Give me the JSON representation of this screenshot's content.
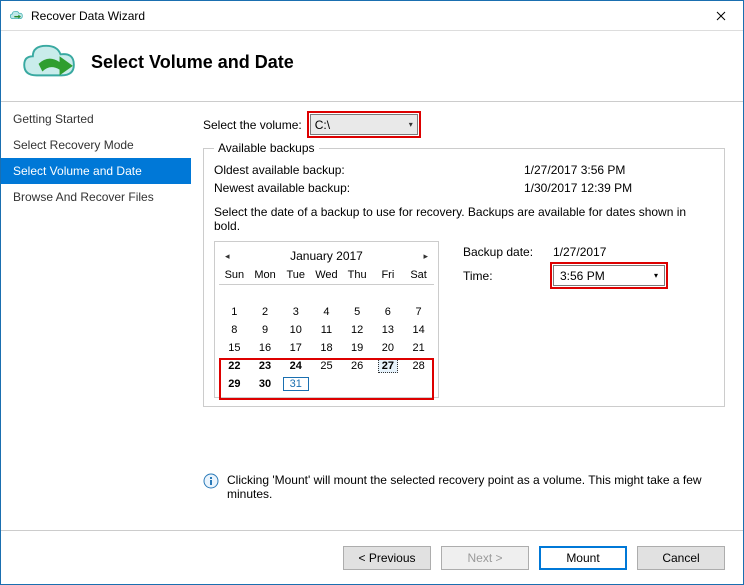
{
  "window": {
    "title": "Recover Data Wizard"
  },
  "header": {
    "title": "Select Volume and Date"
  },
  "sidebar": {
    "items": [
      {
        "label": "Getting Started"
      },
      {
        "label": "Select Recovery Mode"
      },
      {
        "label": "Select Volume and Date"
      },
      {
        "label": "Browse And Recover Files"
      }
    ]
  },
  "form": {
    "select_volume_label": "Select the volume:",
    "volume_value": "C:\\",
    "available_legend": "Available backups",
    "oldest_label": "Oldest available backup:",
    "oldest_value": "1/27/2017 3:56 PM",
    "newest_label": "Newest available backup:",
    "newest_value": "1/30/2017 12:39 PM",
    "instruction": "Select the date of a backup to use for recovery. Backups are available for dates shown in bold.",
    "backup_date_label": "Backup date:",
    "backup_date_value": "1/27/2017",
    "time_label": "Time:",
    "time_value": "3:56 PM"
  },
  "calendar": {
    "month_label": "January 2017",
    "dow": [
      "Sun",
      "Mon",
      "Tue",
      "Wed",
      "Thu",
      "Fri",
      "Sat"
    ],
    "weeks": [
      [
        {
          "n": ""
        },
        {
          "n": ""
        },
        {
          "n": ""
        },
        {
          "n": ""
        },
        {
          "n": ""
        },
        {
          "n": ""
        },
        {
          "n": ""
        }
      ],
      [
        {
          "n": "1"
        },
        {
          "n": "2"
        },
        {
          "n": "3"
        },
        {
          "n": "4"
        },
        {
          "n": "5"
        },
        {
          "n": "6"
        },
        {
          "n": "7"
        }
      ],
      [
        {
          "n": "8"
        },
        {
          "n": "9"
        },
        {
          "n": "10"
        },
        {
          "n": "11"
        },
        {
          "n": "12"
        },
        {
          "n": "13"
        },
        {
          "n": "14"
        }
      ],
      [
        {
          "n": "15"
        },
        {
          "n": "16"
        },
        {
          "n": "17"
        },
        {
          "n": "18"
        },
        {
          "n": "19"
        },
        {
          "n": "20"
        },
        {
          "n": "21"
        }
      ],
      [
        {
          "n": "22",
          "b": true
        },
        {
          "n": "23",
          "b": true
        },
        {
          "n": "24",
          "b": true
        },
        {
          "n": "25"
        },
        {
          "n": "26"
        },
        {
          "n": "27",
          "sel": true
        },
        {
          "n": "28"
        }
      ],
      [
        {
          "n": "29",
          "b": true
        },
        {
          "n": "30",
          "b": true
        },
        {
          "n": "31",
          "today": true
        },
        {
          "n": ""
        },
        {
          "n": ""
        },
        {
          "n": ""
        },
        {
          "n": ""
        }
      ]
    ]
  },
  "info": {
    "text": "Clicking 'Mount' will mount the selected recovery point as a volume. This might take a few minutes."
  },
  "footer": {
    "previous": "< Previous",
    "next": "Next >",
    "mount": "Mount",
    "cancel": "Cancel"
  }
}
